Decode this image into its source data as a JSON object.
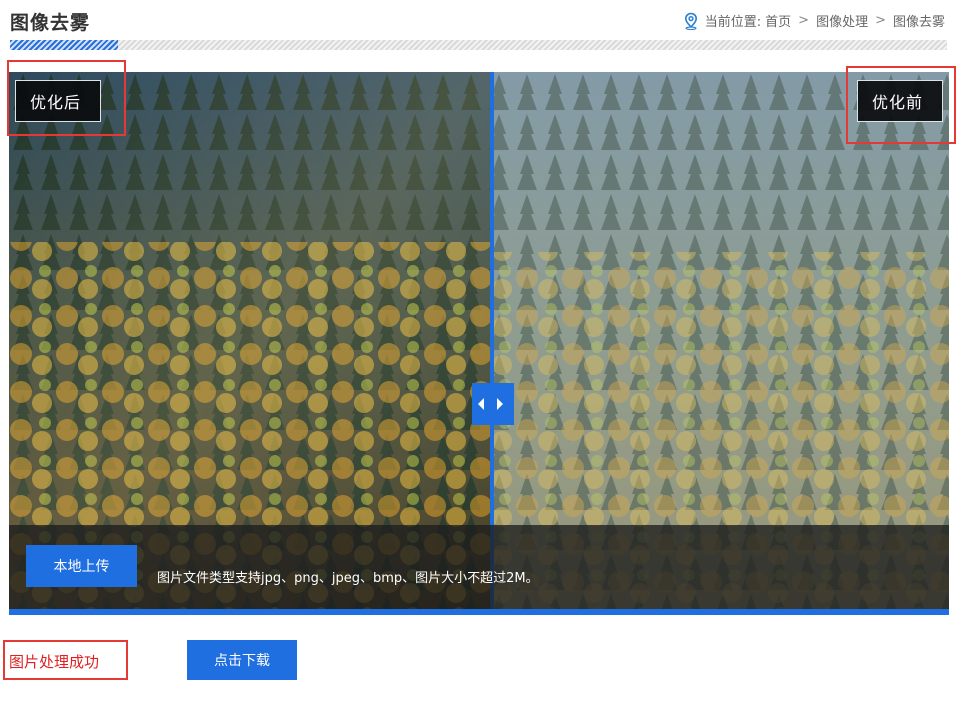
{
  "header": {
    "title": "图像去雾",
    "breadcrumb_prefix": "当前位置:",
    "breadcrumb": [
      "首页",
      "图像处理",
      "图像去雾"
    ],
    "breadcrumb_separator": ">"
  },
  "compare": {
    "label_after": "优化后",
    "label_before": "优化前",
    "upload_button": "本地上传",
    "upload_hint": "图片文件类型支持jpg、png、jpeg、bmp、图片大小不超过2M。"
  },
  "result": {
    "status": "图片处理成功",
    "download_button": "点击下载"
  },
  "colors": {
    "accent": "#1f6fe0",
    "status": "#e02020",
    "annotation": "#e53935"
  },
  "icons": {
    "location": "map-pin-icon",
    "handle_left": "triangle-left-icon",
    "handle_right": "triangle-right-icon"
  }
}
